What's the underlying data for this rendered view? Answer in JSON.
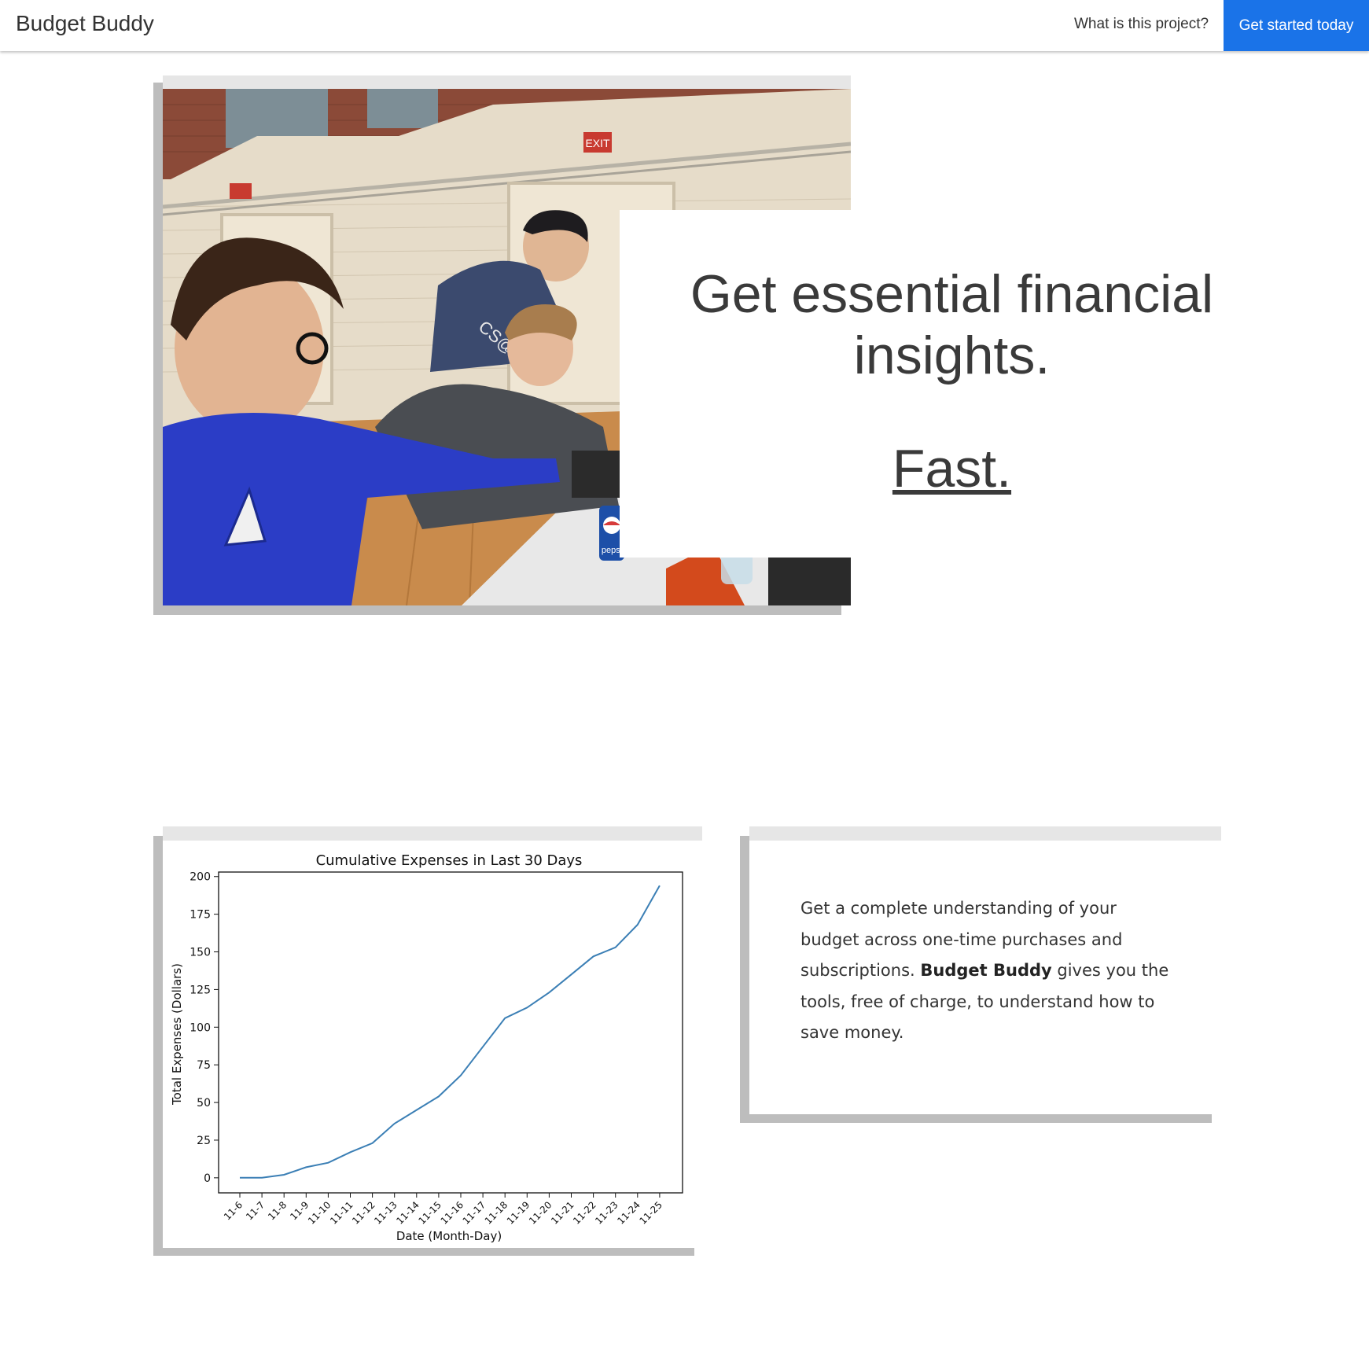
{
  "navbar": {
    "brand": "Budget Buddy",
    "link_label": "What is this project?",
    "cta_label": "Get started today",
    "cta_color": "#1a73e8"
  },
  "hero": {
    "title": "Get essential financial insights.",
    "emphasis": "Fast.",
    "photo": {
      "description_icon": "team-photo-image",
      "exit_sign_text": "EXIT",
      "shirt_text": "CS@",
      "can_text": "pepsi"
    }
  },
  "info": {
    "text_before": "Get a complete understanding of your budget across one-time purchases and subscriptions. ",
    "text_bold": "Budget Buddy",
    "text_after": " gives you the tools, free of charge, to understand how to save money."
  },
  "chart_data": {
    "type": "line",
    "title": "Cumulative Expenses in Last 30 Days",
    "xlabel": "Date (Month-Day)",
    "ylabel": "Total Expenses (Dollars)",
    "categories": [
      "11-6",
      "11-7",
      "11-8",
      "11-9",
      "11-10",
      "11-11",
      "11-12",
      "11-13",
      "11-14",
      "11-15",
      "11-16",
      "11-17",
      "11-18",
      "11-19",
      "11-20",
      "11-21",
      "11-22",
      "11-23",
      "11-24",
      "11-25"
    ],
    "values": [
      0,
      0,
      2,
      7,
      10,
      17,
      23,
      36,
      45,
      54,
      68,
      87,
      106,
      113,
      123,
      135,
      147,
      153,
      168,
      194
    ],
    "ylim": [
      -10,
      203
    ],
    "yticks": [
      0,
      25,
      50,
      75,
      100,
      125,
      150,
      175,
      200
    ],
    "line_color": "#3b7fb5",
    "grid": false
  }
}
